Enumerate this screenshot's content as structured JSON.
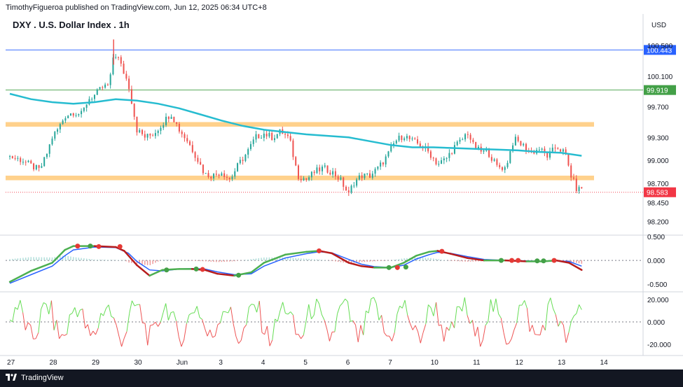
{
  "header": {
    "published_by": "TimothyFigueroa published on TradingView.com, Jun 12, 2025 06:34 UTC+8"
  },
  "footer": {
    "brand": "TradingView",
    "logo_icon": "tradingview-logo-icon"
  },
  "colors": {
    "candle_up": "#26a69a",
    "candle_down": "#ef5350",
    "ma_line": "#26bcd0",
    "zone_fill": "#ffcc80",
    "blue_level": "#2962ff",
    "green_level": "#43a047",
    "current_price": "#f23645",
    "wt_fast": "#4caf50",
    "wt_fast_down": "#b71c1c",
    "wt_slow": "#2962ff",
    "osc_up": "#66dd55",
    "osc_down": "#ee5555"
  },
  "chart_data": [
    {
      "type": "candlestick",
      "title": "DXY . U.S. Dollar Index . 1h",
      "currency": "USD",
      "ylim": [
        98.05,
        100.62
      ],
      "y_ticks": [
        "100.500",
        "100.100",
        "99.700",
        "99.300",
        "99.000",
        "98.700",
        "98.450",
        "98.200"
      ],
      "x_ticks": [
        "27",
        "28",
        "29",
        "30",
        "Jun",
        "3",
        "4",
        "5",
        "6",
        "7",
        "10",
        "11",
        "12",
        "13",
        "14"
      ],
      "price_levels": [
        {
          "label": "100.443",
          "value": 100.443,
          "color": "#2962ff"
        },
        {
          "label": "99.919",
          "value": 99.919,
          "color": "#43a047"
        },
        {
          "label": "98.583",
          "value": 98.583,
          "color": "#f23645"
        }
      ],
      "zones": [
        {
          "from": 99.44,
          "to": 99.5
        },
        {
          "from": 98.74,
          "to": 98.8
        }
      ],
      "close_path": [
        [
          27.0,
          99.05
        ],
        [
          27.3,
          99.0
        ],
        [
          27.5,
          98.93
        ],
        [
          27.7,
          98.87
        ],
        [
          27.85,
          99.05
        ],
        [
          28.0,
          99.3
        ],
        [
          28.15,
          99.42
        ],
        [
          28.3,
          99.58
        ],
        [
          28.5,
          99.63
        ],
        [
          28.7,
          99.6
        ],
        [
          28.85,
          99.8
        ],
        [
          29.0,
          99.85
        ],
        [
          29.2,
          99.96
        ],
        [
          29.35,
          99.98
        ],
        [
          29.45,
          100.4
        ],
        [
          29.55,
          100.35
        ],
        [
          29.65,
          100.2
        ],
        [
          29.8,
          100.0
        ],
        [
          29.9,
          99.7
        ],
        [
          30.0,
          99.4
        ],
        [
          30.2,
          99.3
        ],
        [
          30.4,
          99.35
        ],
        [
          30.6,
          99.48
        ],
        [
          30.8,
          99.62
        ],
        [
          31.0,
          99.4
        ],
        [
          31.2,
          99.25
        ],
        [
          31.4,
          99.05
        ],
        [
          31.6,
          98.82
        ],
        [
          31.8,
          98.8
        ],
        [
          32.0,
          98.85
        ],
        [
          32.2,
          98.75
        ],
        [
          32.4,
          98.95
        ],
        [
          32.6,
          99.1
        ],
        [
          32.8,
          99.3
        ],
        [
          33.0,
          99.35
        ],
        [
          33.2,
          99.3
        ],
        [
          33.4,
          99.38
        ],
        [
          33.6,
          99.28
        ],
        [
          33.8,
          98.8
        ],
        [
          34.0,
          98.75
        ],
        [
          34.2,
          98.85
        ],
        [
          34.4,
          98.9
        ],
        [
          34.6,
          98.85
        ],
        [
          34.8,
          98.75
        ],
        [
          35.0,
          98.55
        ],
        [
          35.1,
          98.7
        ],
        [
          35.3,
          98.8
        ],
        [
          35.5,
          98.8
        ],
        [
          35.7,
          98.9
        ],
        [
          35.9,
          99.05
        ],
        [
          36.1,
          99.25
        ],
        [
          36.3,
          99.33
        ],
        [
          36.5,
          99.25
        ],
        [
          36.7,
          99.2
        ],
        [
          36.9,
          99.1
        ],
        [
          37.1,
          98.95
        ],
        [
          37.3,
          99.02
        ],
        [
          37.5,
          99.18
        ],
        [
          37.7,
          99.28
        ],
        [
          37.8,
          99.38
        ],
        [
          37.95,
          99.18
        ],
        [
          38.1,
          99.12
        ],
        [
          38.3,
          99.1
        ],
        [
          38.5,
          98.92
        ],
        [
          38.7,
          98.9
        ],
        [
          38.9,
          99.28
        ],
        [
          39.1,
          99.2
        ],
        [
          39.3,
          99.1
        ],
        [
          39.5,
          99.15
        ],
        [
          39.7,
          99.05
        ],
        [
          39.9,
          99.18
        ],
        [
          40.1,
          99.1
        ],
        [
          40.25,
          98.8
        ],
        [
          40.4,
          98.6
        ],
        [
          40.5,
          98.65
        ]
      ],
      "moving_average": [
        [
          27.0,
          99.87
        ],
        [
          27.5,
          99.8
        ],
        [
          28.0,
          99.76
        ],
        [
          28.5,
          99.74
        ],
        [
          29.0,
          99.76
        ],
        [
          29.5,
          99.8
        ],
        [
          30.0,
          99.78
        ],
        [
          30.5,
          99.74
        ],
        [
          31.0,
          99.68
        ],
        [
          31.5,
          99.6
        ],
        [
          32.0,
          99.52
        ],
        [
          32.5,
          99.45
        ],
        [
          33.0,
          99.4
        ],
        [
          33.5,
          99.37
        ],
        [
          34.0,
          99.34
        ],
        [
          34.5,
          99.32
        ],
        [
          35.0,
          99.3
        ],
        [
          35.5,
          99.25
        ],
        [
          36.0,
          99.2
        ],
        [
          36.5,
          99.17
        ],
        [
          37.0,
          99.17
        ],
        [
          37.5,
          99.16
        ],
        [
          38.0,
          99.15
        ],
        [
          38.5,
          99.14
        ],
        [
          39.0,
          99.13
        ],
        [
          39.5,
          99.11
        ],
        [
          40.0,
          99.1
        ],
        [
          40.5,
          99.06
        ]
      ]
    },
    {
      "type": "line",
      "y_ticks": [
        "0.500",
        "0.000",
        "-0.500"
      ],
      "ylim": [
        -0.6,
        0.5
      ],
      "series": [
        {
          "values": [
            [
              27.0,
              -0.45
            ],
            [
              27.5,
              -0.22
            ],
            [
              28.0,
              -0.05
            ],
            [
              28.3,
              0.22
            ],
            [
              28.5,
              0.3
            ],
            [
              29.0,
              0.3
            ],
            [
              29.5,
              0.28
            ],
            [
              29.7,
              0.2
            ],
            [
              30.0,
              -0.1
            ],
            [
              30.3,
              -0.32
            ],
            [
              30.6,
              -0.2
            ],
            [
              31.0,
              -0.18
            ],
            [
              31.3,
              -0.18
            ],
            [
              31.6,
              -0.2
            ],
            [
              31.9,
              -0.28
            ],
            [
              32.3,
              -0.32
            ],
            [
              32.7,
              -0.25
            ],
            [
              33.0,
              -0.05
            ],
            [
              33.5,
              0.12
            ],
            [
              34.0,
              0.18
            ],
            [
              34.3,
              0.2
            ],
            [
              34.6,
              0.15
            ],
            [
              35.0,
              -0.05
            ],
            [
              35.3,
              -0.12
            ],
            [
              35.6,
              -0.15
            ],
            [
              36.0,
              -0.15
            ],
            [
              36.3,
              -0.05
            ],
            [
              36.6,
              0.1
            ],
            [
              36.9,
              0.18
            ],
            [
              37.1,
              0.2
            ],
            [
              37.4,
              0.14
            ],
            [
              37.8,
              0.05
            ],
            [
              38.2,
              0.0
            ],
            [
              38.7,
              0.0
            ],
            [
              39.2,
              -0.02
            ],
            [
              39.6,
              -0.02
            ],
            [
              39.9,
              0.0
            ],
            [
              40.2,
              -0.05
            ],
            [
              40.5,
              -0.2
            ]
          ]
        },
        {
          "values": [
            [
              27.0,
              -0.48
            ],
            [
              27.5,
              -0.3
            ],
            [
              28.0,
              -0.12
            ],
            [
              28.3,
              0.1
            ],
            [
              28.5,
              0.22
            ],
            [
              29.0,
              0.28
            ],
            [
              29.5,
              0.27
            ],
            [
              29.8,
              0.15
            ],
            [
              30.0,
              -0.02
            ],
            [
              30.3,
              -0.2
            ],
            [
              30.6,
              -0.22
            ],
            [
              31.0,
              -0.18
            ],
            [
              31.3,
              -0.17
            ],
            [
              31.6,
              -0.18
            ],
            [
              31.9,
              -0.24
            ],
            [
              32.3,
              -0.3
            ],
            [
              32.7,
              -0.28
            ],
            [
              33.0,
              -0.12
            ],
            [
              33.5,
              0.05
            ],
            [
              34.0,
              0.14
            ],
            [
              34.3,
              0.18
            ],
            [
              34.6,
              0.16
            ],
            [
              35.0,
              0.02
            ],
            [
              35.3,
              -0.08
            ],
            [
              35.6,
              -0.13
            ],
            [
              36.0,
              -0.15
            ],
            [
              36.3,
              -0.1
            ],
            [
              36.6,
              0.03
            ],
            [
              36.9,
              0.12
            ],
            [
              37.1,
              0.17
            ],
            [
              37.4,
              0.15
            ],
            [
              37.8,
              0.08
            ],
            [
              38.2,
              0.02
            ],
            [
              38.7,
              0.0
            ],
            [
              39.2,
              -0.01
            ],
            [
              39.6,
              -0.02
            ],
            [
              39.9,
              -0.01
            ],
            [
              40.2,
              -0.02
            ],
            [
              40.5,
              -0.12
            ]
          ]
        }
      ],
      "dots": [
        {
          "x": 28.6,
          "y": 0.3,
          "c": "red"
        },
        {
          "x": 28.9,
          "y": 0.3,
          "c": "green"
        },
        {
          "x": 29.1,
          "y": 0.29,
          "c": "red"
        },
        {
          "x": 29.6,
          "y": 0.29,
          "c": "red"
        },
        {
          "x": 30.7,
          "y": -0.2,
          "c": "green"
        },
        {
          "x": 31.4,
          "y": -0.18,
          "c": "green"
        },
        {
          "x": 31.55,
          "y": -0.19,
          "c": "red"
        },
        {
          "x": 32.4,
          "y": -0.31,
          "c": "green"
        },
        {
          "x": 34.3,
          "y": 0.2,
          "c": "red"
        },
        {
          "x": 35.95,
          "y": -0.15,
          "c": "green"
        },
        {
          "x": 36.15,
          "y": -0.15,
          "c": "red"
        },
        {
          "x": 36.35,
          "y": -0.14,
          "c": "green"
        },
        {
          "x": 37.2,
          "y": 0.19,
          "c": "red"
        },
        {
          "x": 38.6,
          "y": 0.0,
          "c": "green"
        },
        {
          "x": 38.85,
          "y": 0.0,
          "c": "red"
        },
        {
          "x": 39.0,
          "y": 0.0,
          "c": "red"
        },
        {
          "x": 39.45,
          "y": -0.01,
          "c": "green"
        },
        {
          "x": 39.6,
          "y": -0.01,
          "c": "green"
        },
        {
          "x": 39.85,
          "y": 0.0,
          "c": "red"
        }
      ]
    },
    {
      "type": "line",
      "y_ticks": [
        "20.000",
        "0.000",
        "-20.000"
      ],
      "ylim": [
        -25,
        25
      ],
      "oscillator_wave_count": 110
    }
  ]
}
